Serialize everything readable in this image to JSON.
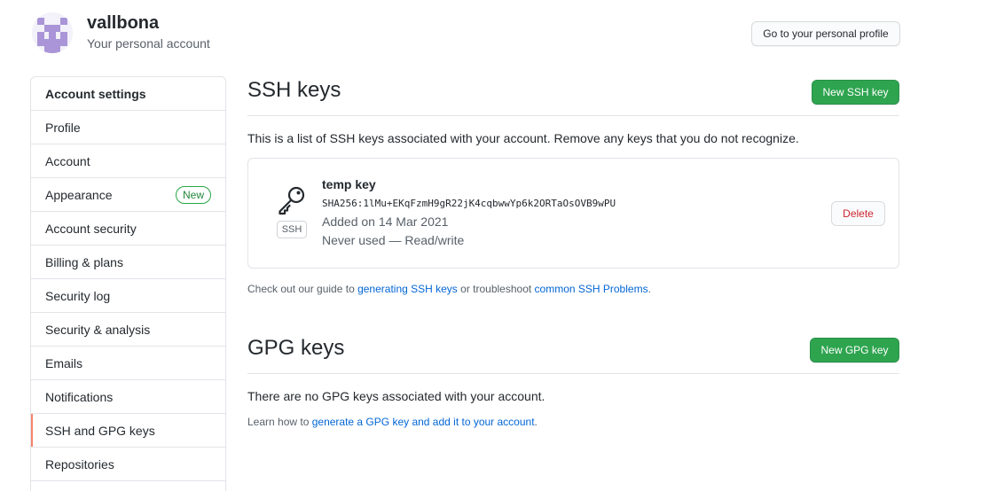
{
  "header": {
    "username": "vallbona",
    "subtitle": "Your personal account",
    "profile_button": "Go to your personal profile"
  },
  "sidebar": {
    "title": "Account settings",
    "items": [
      {
        "label": "Profile"
      },
      {
        "label": "Account"
      },
      {
        "label": "Appearance",
        "badge": "New"
      },
      {
        "label": "Account security"
      },
      {
        "label": "Billing & plans"
      },
      {
        "label": "Security log"
      },
      {
        "label": "Security & analysis"
      },
      {
        "label": "Emails"
      },
      {
        "label": "Notifications"
      },
      {
        "label": "SSH and GPG keys",
        "selected": true
      },
      {
        "label": "Repositories"
      }
    ]
  },
  "ssh": {
    "title": "SSH keys",
    "new_button": "New SSH key",
    "description": "This is a list of SSH keys associated with your account. Remove any keys that you do not recognize.",
    "keys": [
      {
        "icon": "key-icon",
        "type_label": "SSH",
        "title": "temp key",
        "fingerprint": "SHA256:1lMu+EKqFzmH9gR22jK4cqbwwYp6k2ORTaOsOVB9wPU",
        "added": "Added on 14 Mar 2021",
        "usage": "Never used — Read/write",
        "delete_label": "Delete"
      }
    ],
    "guide": {
      "prefix": "Check out our guide to ",
      "link1": "generating SSH keys",
      "middle": " or troubleshoot ",
      "link2": "common SSH Problems",
      "suffix": "."
    }
  },
  "gpg": {
    "title": "GPG keys",
    "new_button": "New GPG key",
    "empty_text": "There are no GPG keys associated with your account.",
    "learn": {
      "prefix": "Learn how to ",
      "link": "generate a GPG key and add it to your account",
      "suffix": "."
    }
  },
  "colors": {
    "green": "#2ea44f",
    "link": "#0366d6",
    "danger": "#cb2431",
    "selected_indicator": "#f9826c"
  }
}
